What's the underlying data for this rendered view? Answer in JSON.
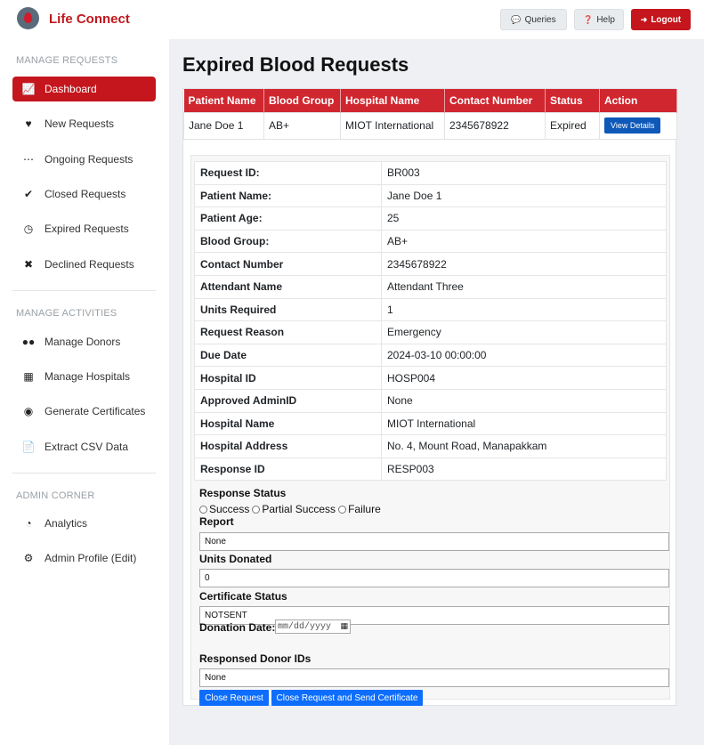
{
  "app": {
    "title": "Life Connect"
  },
  "header": {
    "queries_label": "Queries",
    "help_label": "Help",
    "logout_label": "Logout"
  },
  "sidebar": {
    "sections": [
      {
        "title": "MANAGE REQUESTS"
      },
      {
        "title": "MANAGE ACTIVITIES"
      },
      {
        "title": "ADMIN CORNER"
      }
    ],
    "items": [
      {
        "label": "Dashboard",
        "icon": "chart-line-icon"
      },
      {
        "label": "New Requests",
        "icon": "hand-holding-heart-icon"
      },
      {
        "label": "Ongoing Requests",
        "icon": "spinner-icon"
      },
      {
        "label": "Closed Requests",
        "icon": "check-circle-icon"
      },
      {
        "label": "Expired Requests",
        "icon": "clock-icon"
      },
      {
        "label": "Declined Requests",
        "icon": "times-circle-icon"
      },
      {
        "label": "Manage Donors",
        "icon": "users-icon"
      },
      {
        "label": "Manage Hospitals",
        "icon": "hospital-icon"
      },
      {
        "label": "Generate Certificates",
        "icon": "award-icon"
      },
      {
        "label": "Extract CSV Data",
        "icon": "csv-file-icon"
      },
      {
        "label": "Analytics",
        "icon": "pie-chart-icon"
      },
      {
        "label": "Admin Profile (Edit)",
        "icon": "user-cog-icon"
      }
    ]
  },
  "main": {
    "page_title": "Expired Blood Requests",
    "table": {
      "columns": [
        "Patient Name",
        "Blood Group",
        "Hospital Name",
        "Contact Number",
        "Status",
        "Action"
      ],
      "rows": [
        {
          "patient_name": "Jane Doe 1",
          "blood_group": "AB+",
          "hospital_name": "MIOT International",
          "contact_number": "2345678922",
          "status": "Expired",
          "action_label": "View Details"
        }
      ]
    },
    "details": [
      {
        "key": "Request ID:",
        "value": "BR003"
      },
      {
        "key": "Patient Name:",
        "value": "Jane Doe 1"
      },
      {
        "key": "Patient Age:",
        "value": "25"
      },
      {
        "key": "Blood Group:",
        "value": "AB+"
      },
      {
        "key": "Contact Number",
        "value": "2345678922"
      },
      {
        "key": "Attendant Name",
        "value": "Attendant Three"
      },
      {
        "key": "Units Required",
        "value": "1"
      },
      {
        "key": "Request Reason",
        "value": "Emergency"
      },
      {
        "key": "Due Date",
        "value": "2024-03-10 00:00:00"
      },
      {
        "key": "Hospital ID",
        "value": "HOSP004"
      },
      {
        "key": "Approved AdminID",
        "value": "None"
      },
      {
        "key": "Hospital Name",
        "value": "MIOT International"
      },
      {
        "key": "Hospital Address",
        "value": "No. 4, Mount Road, Manapakkam"
      },
      {
        "key": "Response ID",
        "value": "RESP003"
      }
    ],
    "form": {
      "response_status_label": "Response Status",
      "status_options": [
        "Success",
        "Partial Success",
        "Failure"
      ],
      "report_label": "Report",
      "report_value": "None",
      "units_donated_label": "Units Donated",
      "units_donated_value": "0",
      "certificate_status_label": "Certificate Status",
      "certificate_status_value": "NOTSENT",
      "donation_date_label": "Donation Date:",
      "donation_date_placeholder": "mm/dd/yyyy",
      "responsed_donor_ids_label": "Responsed Donor IDs",
      "responsed_donor_ids_value": "None",
      "close_request_label": "Close Request",
      "close_send_cert_label": "Close Request and Send Certificate"
    }
  },
  "colors": {
    "brand_red": "#c4161c",
    "table_header_red": "#d0262f",
    "view_button_blue": "#0d58b8",
    "action_button_blue": "#0d6efd"
  }
}
